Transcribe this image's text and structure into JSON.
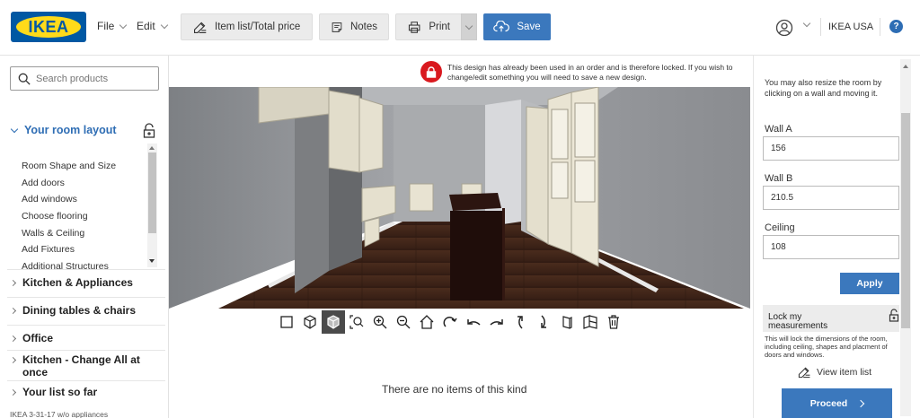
{
  "header": {
    "logo_text": "IKEA",
    "menus": [
      {
        "label": "File"
      },
      {
        "label": "Edit"
      }
    ],
    "toolbar": {
      "item_list_label": "Item list/Total price",
      "notes_label": "Notes",
      "print_label": "Print",
      "save_label": "Save"
    },
    "store_label": "IKEA USA",
    "help_label": "?"
  },
  "sidebar": {
    "search_placeholder": "Search products",
    "open_section": "Your room layout",
    "room_layout_items": [
      "Room Shape and Size",
      "Add doors",
      "Add windows",
      "Choose flooring",
      "Walls & Ceiling",
      "Add Fixtures",
      "Additional Structures"
    ],
    "sections": [
      "Kitchen & Appliances",
      "Dining tables & chairs",
      "Office",
      "Kitchen - Change All at once",
      "Your list so far"
    ],
    "footer_note": "IKEA 3-31-17 w/o appliances"
  },
  "center": {
    "lock_message": "This design has already been used in an order and is therefore locked. If you wish to change/edit something you will need to save a new design.",
    "empty_message": "There are no items of this kind",
    "tools": [
      "2d-view-icon",
      "3d-box-view-icon",
      "3d-view-icon",
      "zoom-fit-icon",
      "zoom-in-icon",
      "zoom-out-icon",
      "home-view-icon",
      "rotate-right-icon",
      "pan-left-icon",
      "pan-right-icon",
      "tilt-up-icon",
      "tilt-down-icon",
      "wall-view-icon",
      "walls-toggle-icon",
      "trash-icon"
    ]
  },
  "right_panel": {
    "resize_note": "You may also resize the room by clicking on a wall and moving it.",
    "wall_a_label": "Wall A",
    "wall_a_value": "156",
    "wall_b_label": "Wall B",
    "wall_b_value": "210.5",
    "ceiling_label": "Ceiling",
    "ceiling_value": "108",
    "apply_label": "Apply",
    "lock_title": "Lock my measurements",
    "lock_desc": "This will lock the dimensions of the room, including ceiling, shapes and placment of doors and windows.",
    "view_item_list_label": "View item list",
    "proceed_label": "Proceed"
  },
  "colors": {
    "brand_blue": "#0058a3",
    "brand_yellow": "#ffda1a",
    "button_blue": "#3b78bd",
    "link_blue": "#2e6db4",
    "lock_red": "#d9191f",
    "floor_brown": "#3e2418",
    "wall_gray": "#8b8d90"
  }
}
